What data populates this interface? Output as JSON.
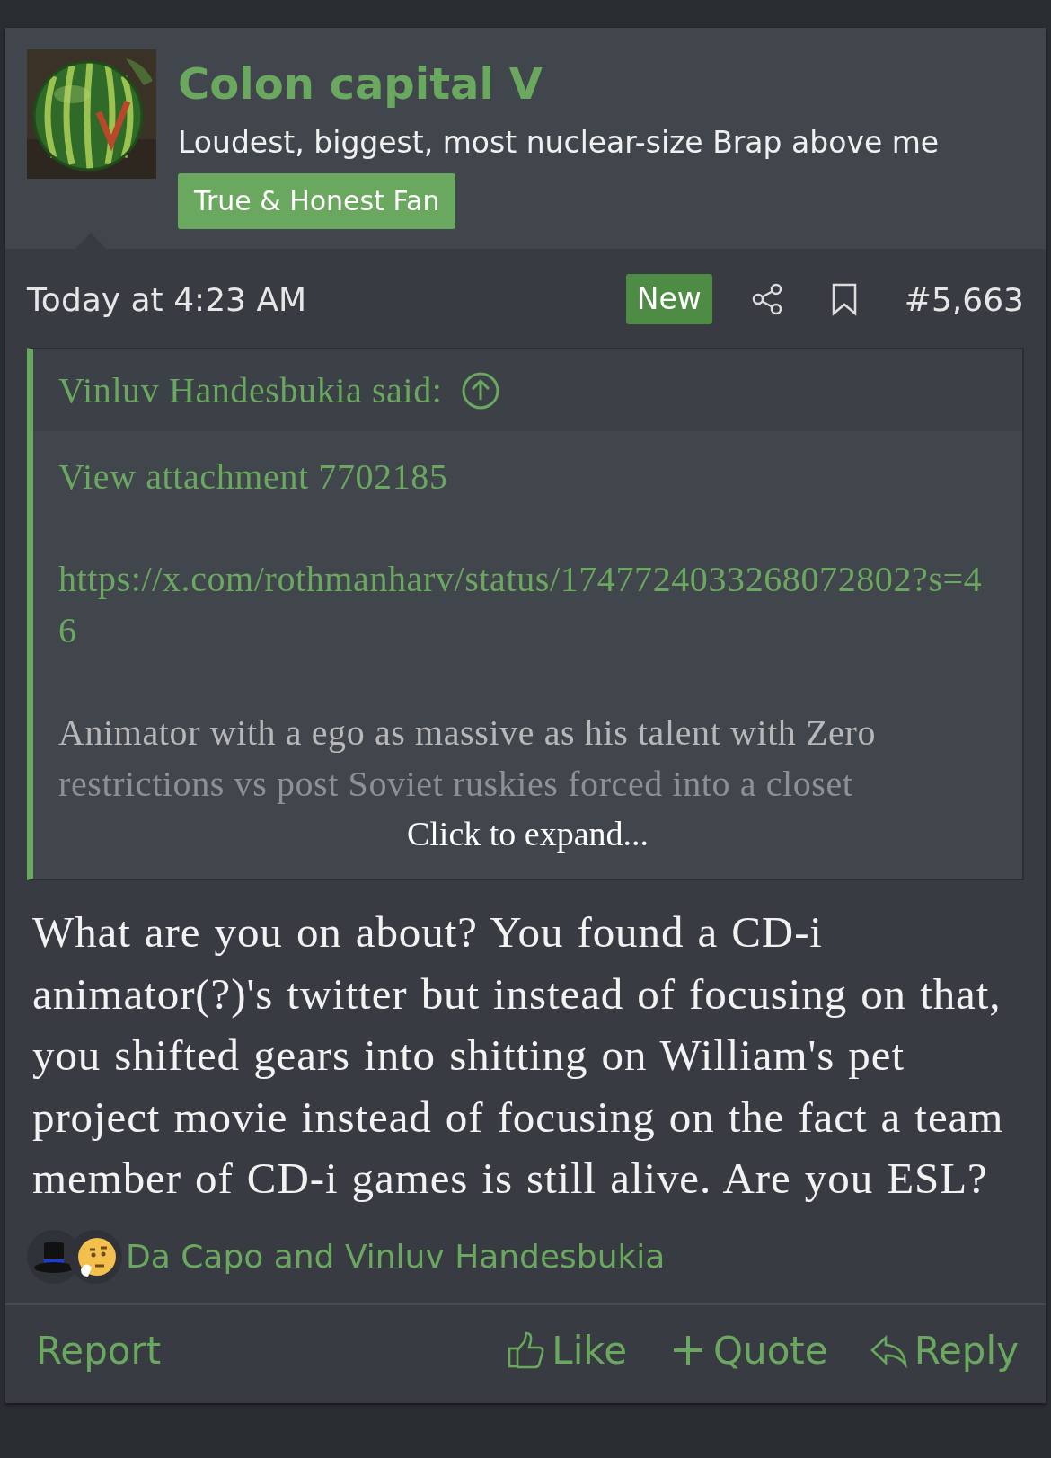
{
  "author": {
    "name": "Colon capital V",
    "user_title": "Loudest, biggest, most nuclear-size Brap above me",
    "banner": "True & Honest Fan"
  },
  "meta": {
    "time": "Today at 4:23 AM",
    "badge": "New",
    "number": "#5,663"
  },
  "quote": {
    "attribution": "Vinluv Handesbukia said:",
    "lines": [
      {
        "kind": "link",
        "text": "View attachment 7702185"
      },
      {
        "kind": "link",
        "text": "https://x.com/rothmanharv/status/1747724033268072802?s=46"
      },
      {
        "kind": "text",
        "text": "Animator with a ego as massive as his talent with Zero"
      },
      {
        "kind": "faded",
        "text": "restrictions vs post Soviet ruskies forced into a closet"
      }
    ],
    "expand": "Click to expand..."
  },
  "body": "What are you on about? You found a CD-i animator(?)'s twitter but instead of focusing on that, you shifted gears into shitting on William's pet project movie instead of focusing on the fact a team member of CD-i games is still alive. Are you ESL?",
  "reactions": {
    "text": "Da Capo and Vinluv Handesbukia"
  },
  "actions": [
    {
      "kind": "report",
      "label": "Report"
    },
    {
      "kind": "like",
      "label": "Like"
    },
    {
      "kind": "quote",
      "label": "Quote"
    },
    {
      "kind": "reply",
      "label": "Reply"
    }
  ]
}
